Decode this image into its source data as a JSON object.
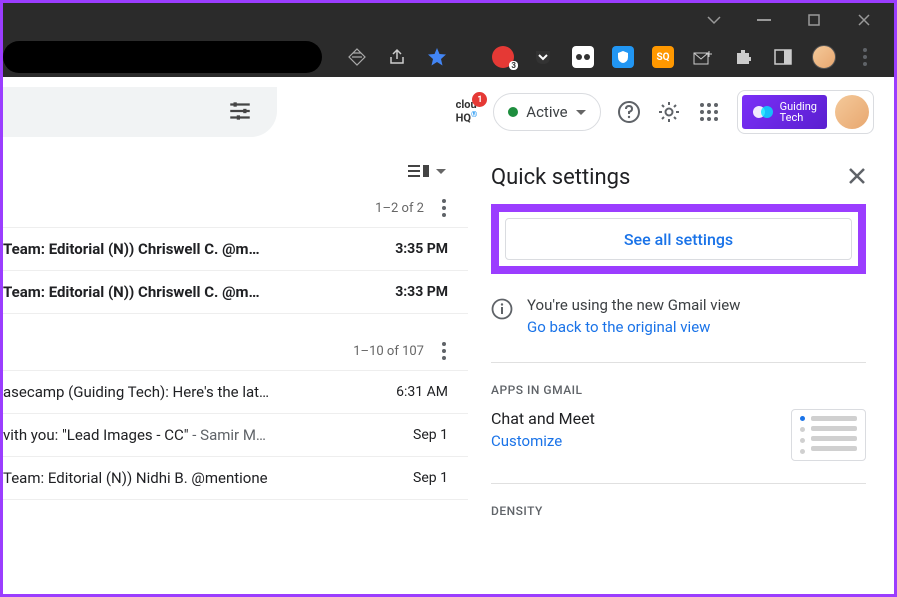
{
  "window": {
    "minimize": "—",
    "maximize": "□",
    "close": "✕"
  },
  "browser": {
    "star_color": "#4285f4",
    "ext_badge": "3",
    "sq_label": "SQ"
  },
  "toolbar": {
    "cloudhq": "clou\nHQ",
    "cloudhq_badge": "1",
    "active_label": "Active",
    "brand1": "Guiding",
    "brand2": "Tech"
  },
  "mail": {
    "pager1": "1–2 of 2",
    "rows1": [
      {
        "subj": "Team: Editorial (N)) Chriswell C. @m…",
        "time": "3:35 PM"
      },
      {
        "subj": "Team: Editorial (N)) Chriswell C. @m…",
        "time": "3:33 PM"
      }
    ],
    "pager2": "1–10 of 107",
    "rows2": [
      {
        "subj": "asecamp (Guiding Tech): Here's the lat…",
        "time": "6:31 AM"
      },
      {
        "subj_a": "vith you: \"Lead Images - CC\" ",
        "subj_b": "- Samir M…",
        "time": "Sep 1"
      },
      {
        "subj_a": "Team: Editorial (N)) Nidhi B. @mentione",
        "subj_b": "",
        "time": "Sep 1"
      }
    ]
  },
  "settings": {
    "title": "Quick settings",
    "see_all": "See all settings",
    "info_text": "You're using the new Gmail view",
    "info_link": "Go back to the original view",
    "apps_section": "APPS IN GMAIL",
    "chat_label": "Chat and Meet",
    "customize": "Customize",
    "density_section": "DENSITY"
  }
}
